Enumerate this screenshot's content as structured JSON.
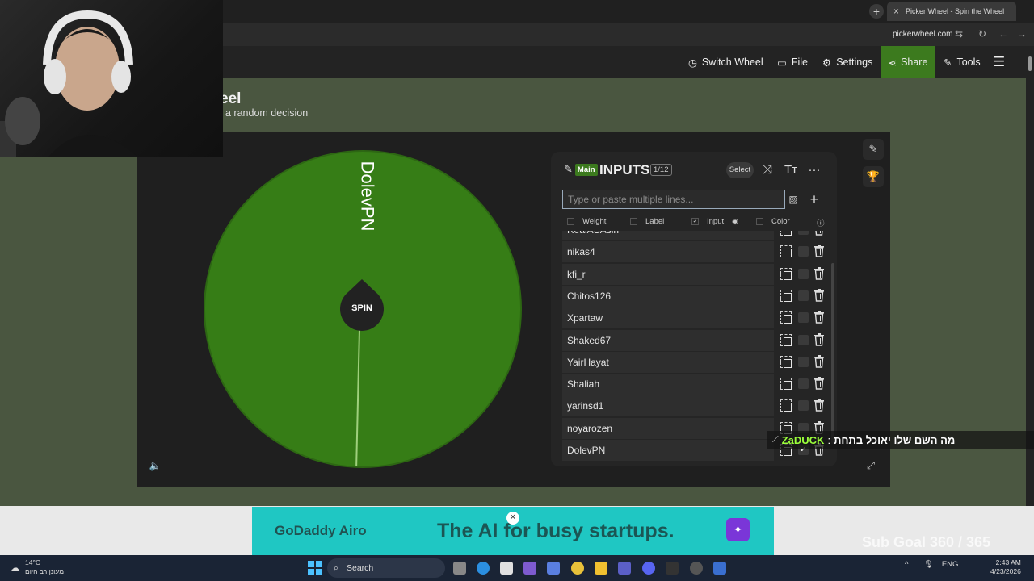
{
  "browser": {
    "tab_title": "Picker Wheel - Spin the Wheel",
    "new_tab_symbol": "+",
    "close_symbol": "×",
    "url": "pickerwheel.com"
  },
  "site_nav": {
    "switch_wheel": "Switch Wheel",
    "file": "File",
    "settings": "Settings",
    "share": "Share",
    "tools": "Tools"
  },
  "page": {
    "title_fragment": "eel",
    "subtitle_fragment": "a random decision"
  },
  "wheel": {
    "slice_label": "DolevPN",
    "spin_label": "SPIN",
    "color": "#367d16"
  },
  "inputs_panel": {
    "main_tag": "Main",
    "title": "INPUTS",
    "count": "1/12",
    "select_label": "Select",
    "placeholder": "Type or paste multiple lines...",
    "columns": [
      "Weight",
      "Label",
      "Input",
      "Color"
    ],
    "entries": [
      {
        "name": "RealASAsin",
        "checked": false
      },
      {
        "name": "nikas4",
        "checked": false
      },
      {
        "name": "kfi_r",
        "checked": false
      },
      {
        "name": "Chitos126",
        "checked": false
      },
      {
        "name": "Xpartaw",
        "checked": false
      },
      {
        "name": "Shaked67",
        "checked": false
      },
      {
        "name": "YairHayat",
        "checked": false
      },
      {
        "name": "Shaliah",
        "checked": false
      },
      {
        "name": "yarinsd1",
        "checked": false
      },
      {
        "name": "noyarozen",
        "checked": false
      },
      {
        "name": "DolevPN",
        "checked": true
      }
    ]
  },
  "chat_overlay": {
    "user": "ZaDUCK",
    "separator": ":",
    "message": "מה השם שלו יאוכל בתחת"
  },
  "ad": {
    "brand": "GoDaddy Airo",
    "headline": "The AI for busy startups."
  },
  "stream_overlay": {
    "sub_goal": "Sub Goal 360 / 365"
  },
  "taskbar": {
    "temperature": "14°C",
    "weather_text": "מעונן רב היום",
    "search_label": "Search",
    "language": "ENG",
    "time": "2:43 AM",
    "date": "4/23/2026"
  }
}
